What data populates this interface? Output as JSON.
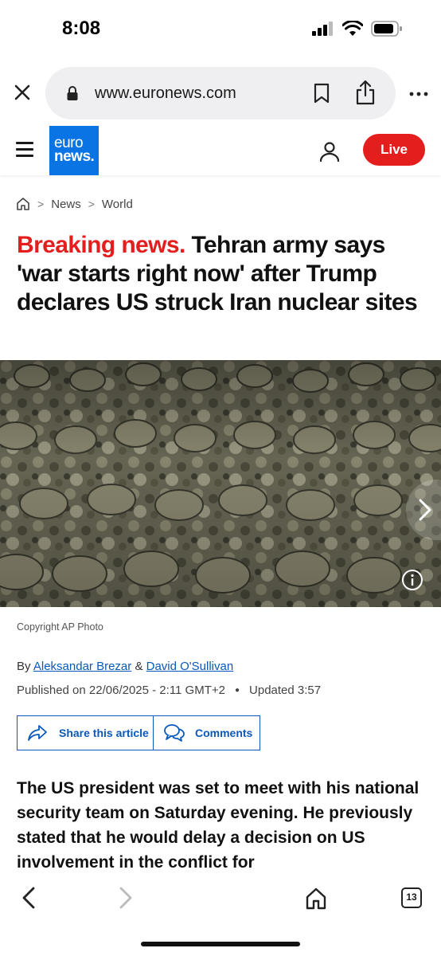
{
  "status": {
    "time": "8:08"
  },
  "browser": {
    "url": "www.euronews.com"
  },
  "site": {
    "logo_line1": "euro",
    "logo_line2": "news.",
    "live_label": "Live",
    "brand_color": "#0a74e5",
    "live_color": "#e41d1d"
  },
  "breadcrumb": {
    "items": [
      "News",
      "World"
    ]
  },
  "headline": {
    "prefix": "Breaking news.",
    "text": "Tehran army says 'war starts right now' after Trump declares US struck Iran nuclear sites"
  },
  "photo": {
    "copyright": "Copyright AP Photo"
  },
  "byline": {
    "by": "By",
    "author1": "Aleksandar Brezar",
    "amp": "&",
    "author2": "David O'Sullivan",
    "published": "Published on 22/06/2025 - 2:11 GMT+2",
    "updated": "Updated 3:57"
  },
  "actions": {
    "share_label": "Share this article",
    "comments_label": "Comments"
  },
  "article": {
    "lead": "The US president was set to meet with his national security team on Saturday evening. He previously stated that he would delay a decision on US involvement in the conflict for"
  },
  "toolbar": {
    "tab_count": "13"
  },
  "icons": [
    "signal-icon",
    "wifi-icon",
    "battery-icon",
    "close-icon",
    "lock-icon",
    "bookmark-icon",
    "share-icon",
    "more-icon",
    "menu-icon",
    "user-icon",
    "home-icon",
    "chevron-right-icon",
    "info-icon",
    "back-icon",
    "forward-icon",
    "tabs-icon"
  ]
}
